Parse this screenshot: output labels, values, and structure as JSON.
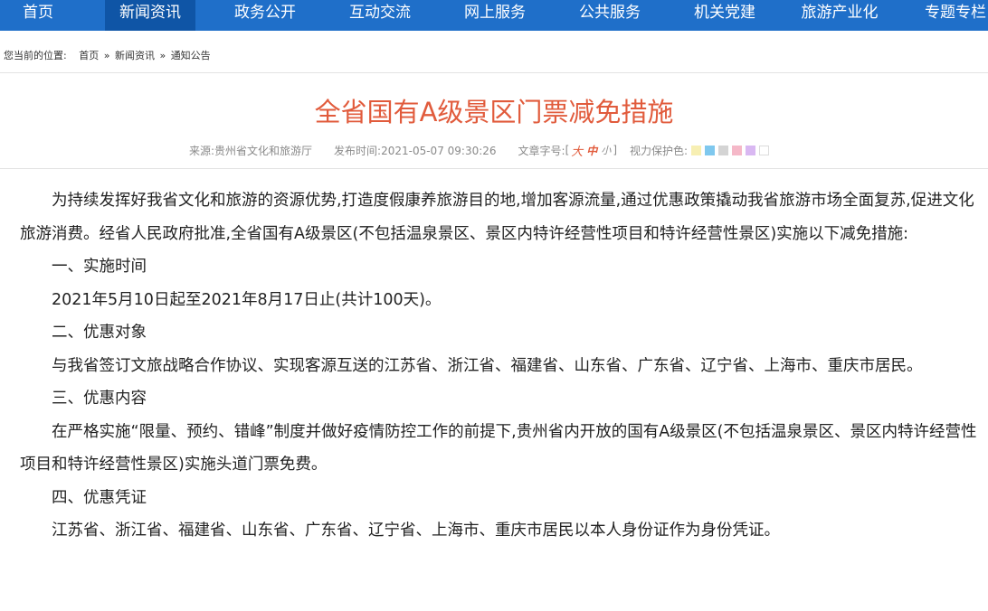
{
  "nav": {
    "items": [
      "首页",
      "新闻资讯",
      "政务公开",
      "互动交流",
      "网上服务",
      "公共服务",
      "机关党建",
      "旅游产业化",
      "专题专栏"
    ],
    "active_index": 1
  },
  "breadcrumb": {
    "lead": "您当前的位置:",
    "items": [
      "首页",
      "新闻资讯",
      "通知公告"
    ],
    "separator": "»"
  },
  "article": {
    "title": "全省国有A级景区门票减免措施",
    "meta": {
      "source": "来源:贵州省文化和旅游厅",
      "publish_time": "发布时间:2021-05-07 09:30:26",
      "font_size_label": "文章字号:",
      "font_sizes": {
        "open": "[",
        "big": "大",
        "mid": "中",
        "small": "小",
        "close": "]"
      },
      "eye_care_label": "视力保护色:",
      "eye_care_colors": [
        "#f7efb3",
        "#7fc8ee",
        "#d4d4d4",
        "#f5b8c8",
        "#d9b8f2",
        "#ffffff"
      ]
    },
    "paragraphs": [
      "为持续发挥好我省文化和旅游的资源优势,打造度假康养旅游目的地,增加客源流量,通过优惠政策撬动我省旅游市场全面复苏,促进文化旅游消费。经省人民政府批准,全省国有A级景区(不包括温泉景区、景区内特许经营性项目和特许经营性景区)实施以下减免措施:",
      "一、实施时间",
      "2021年5月10日起至2021年8月17日止(共计100天)。",
      "二、优惠对象",
      "与我省签订文旅战略合作协议、实现客源互送的江苏省、浙江省、福建省、山东省、广东省、辽宁省、上海市、重庆市居民。",
      "三、优惠内容",
      "在严格实施“限量、预约、错峰”制度并做好疫情防控工作的前提下,贵州省内开放的国有A级景区(不包括温泉景区、景区内特许经营性项目和特许经营性景区)实施头道门票免费。",
      "四、优惠凭证",
      "江苏省、浙江省、福建省、山东省、广东省、辽宁省、上海市、重庆市居民以本人身份证作为身份凭证。"
    ]
  }
}
